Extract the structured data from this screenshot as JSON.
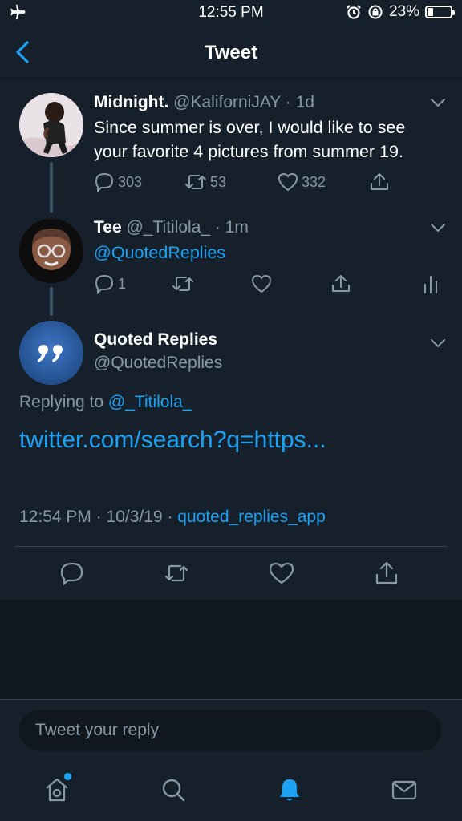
{
  "status_bar": {
    "time": "12:55 PM",
    "battery": "23%",
    "icons": [
      "airplane-icon",
      "alarm-icon",
      "orientation-lock-icon",
      "battery-icon"
    ]
  },
  "nav": {
    "title": "Tweet",
    "back_icon": "chevron-left-icon"
  },
  "colors": {
    "background": "#15202b",
    "accent": "#1da1f2",
    "secondary_text": "#8899a6",
    "divider": "#38444d"
  },
  "tweets": [
    {
      "name": "Midnight.",
      "handle": "@KaliforniJAY",
      "time": "· 1d",
      "text_line1": "Since summer is over, I would like to see",
      "text_line2": "your favorite 4 pictures from summer 19.",
      "replies": "303",
      "retweets": "53",
      "likes": "332"
    },
    {
      "name": "Tee",
      "handle": "@_Titilola_",
      "time": "· 1m",
      "text": "@QuotedReplies",
      "replies": "1"
    },
    {
      "name": "Quoted Replies",
      "handle": "@QuotedReplies",
      "replying_prefix": "Replying to",
      "replying_to": "@_Titilola_",
      "link": "twitter.com/search?q=https...",
      "timestamp": "12:54 PM · 10/3/19 ·",
      "source": "quoted_replies_app"
    }
  ],
  "compose": {
    "placeholder": "Tweet your reply"
  },
  "tabs": [
    "home-icon",
    "search-icon",
    "notifications-icon",
    "messages-icon"
  ]
}
